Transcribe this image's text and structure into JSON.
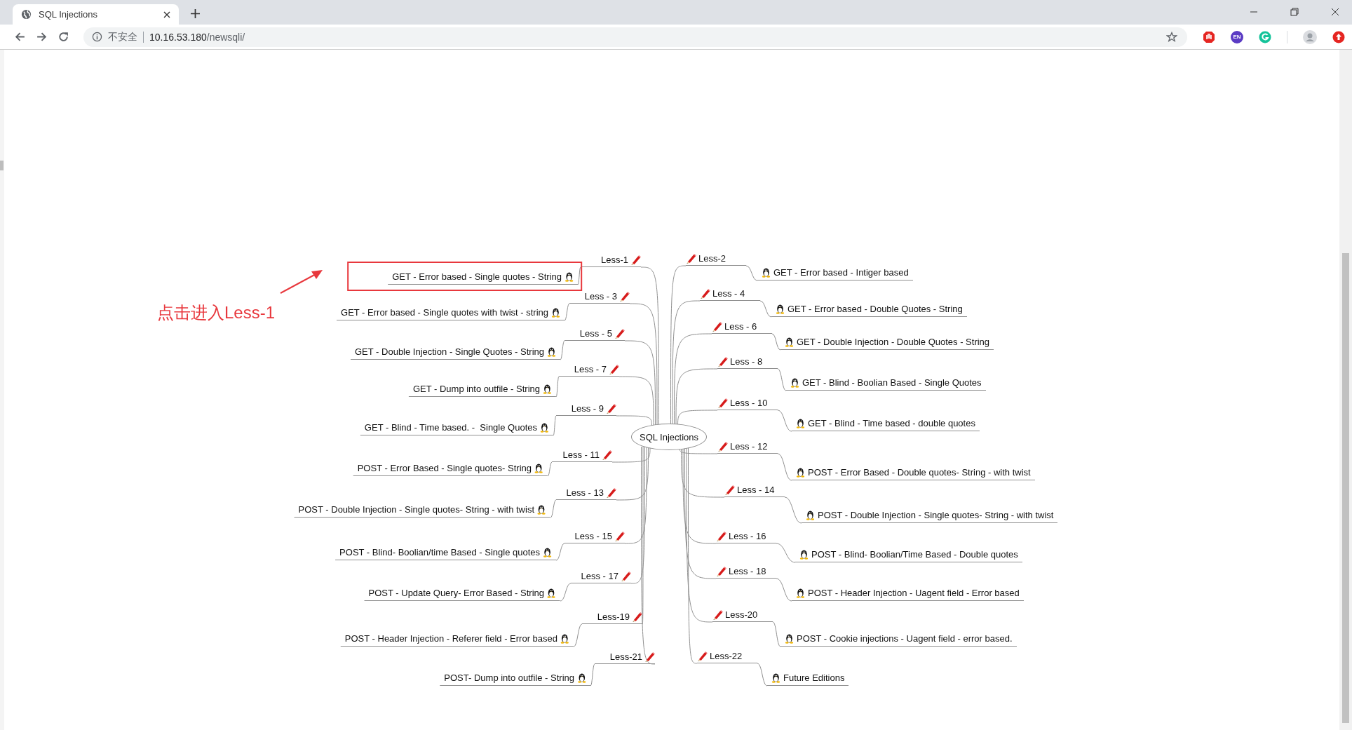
{
  "browser": {
    "tab": {
      "title": "SQL Injections"
    },
    "address": {
      "security": "不安全",
      "host": "10.16.53.180",
      "path": "/newsqli/"
    },
    "extensions": [
      {
        "kind": "block"
      },
      {
        "kind": "lang",
        "text": "EN"
      },
      {
        "kind": "grammar"
      }
    ]
  },
  "mindmap": {
    "center": "SQL Injections",
    "branches": [
      {
        "label": "Less-1",
        "title": "GET - Error based - Single quotes - String",
        "highlighted": true
      },
      {
        "label": "Less-2",
        "title": "GET - Error based - Intiger based",
        "highlighted": false
      },
      {
        "label": "Less - 3",
        "title": "GET - Error based - Single quotes with twist - string",
        "highlighted": false
      },
      {
        "label": "Less - 4",
        "title": "GET - Error based - Double Quotes - String",
        "highlighted": false
      },
      {
        "label": "Less - 5",
        "title": "GET - Double Injection - Single Quotes - String",
        "highlighted": false
      },
      {
        "label": "Less - 6",
        "title": "GET - Double Injection - Double Quotes - String",
        "highlighted": false
      },
      {
        "label": "Less - 7",
        "title": "GET - Dump into outfile - String",
        "highlighted": false
      },
      {
        "label": "Less - 8",
        "title": "GET - Blind - Boolian Based - Single Quotes",
        "highlighted": false
      },
      {
        "label": "Less - 9",
        "title": "GET - Blind - Time based. -  Single Quotes",
        "highlighted": false
      },
      {
        "label": "Less - 10",
        "title": "GET - Blind - Time based - double quotes",
        "highlighted": false
      },
      {
        "label": "Less - 11",
        "title": "POST - Error Based - Single quotes- String",
        "highlighted": false
      },
      {
        "label": "Less - 12",
        "title": "POST - Error Based - Double quotes- String - with twist",
        "highlighted": false
      },
      {
        "label": "Less - 13",
        "title": "POST - Double Injection - Single quotes- String - with twist",
        "highlighted": false
      },
      {
        "label": "Less - 14",
        "title": "POST - Double Injection - Single quotes- String - with twist",
        "highlighted": false
      },
      {
        "label": "Less - 15",
        "title": "POST - Blind- Boolian/time Based - Single quotes",
        "highlighted": false
      },
      {
        "label": "Less - 16",
        "title": "POST - Blind- Boolian/Time Based - Double quotes",
        "highlighted": false
      },
      {
        "label": "Less - 17",
        "title": "POST - Update Query- Error Based - String",
        "highlighted": false
      },
      {
        "label": "Less - 18",
        "title": "POST - Header Injection - Uagent field - Error based",
        "highlighted": false
      },
      {
        "label": "Less-19",
        "title": "POST - Header Injection - Referer field - Error based",
        "highlighted": false
      },
      {
        "label": "Less-20",
        "title": "POST - Cookie injections - Uagent field - error based.",
        "highlighted": false
      },
      {
        "label": "Less-21",
        "title": "POST- Dump into outfile - String",
        "highlighted": false
      },
      {
        "label": "Less-22",
        "title": "Future Editions",
        "highlighted": false
      }
    ]
  },
  "annotation": {
    "text": "点击进入Less-1"
  }
}
